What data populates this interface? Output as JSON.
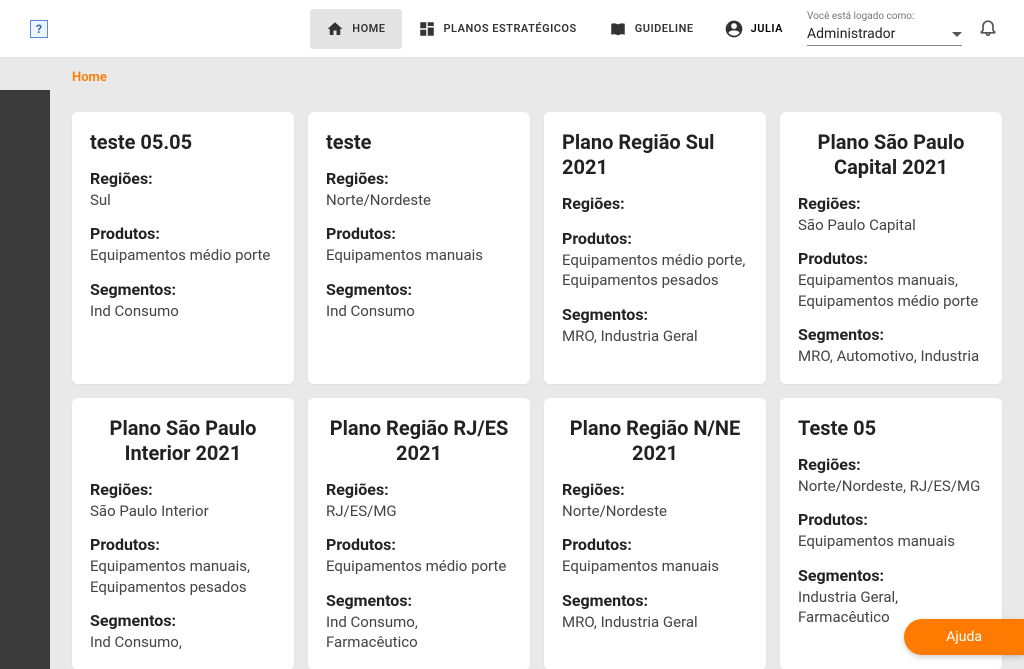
{
  "nav": {
    "home": "HOME",
    "planos": "PLANOS ESTRATÉGICOS",
    "guideline": "GUIDELINE",
    "user": "JULIA"
  },
  "role": {
    "label": "Você está logado como:",
    "value": "Administrador"
  },
  "breadcrumb": "Home",
  "labels": {
    "regioes": "Regiões:",
    "produtos": "Produtos:",
    "segmentos": "Segmentos:"
  },
  "cards": [
    {
      "title": "teste 05.05",
      "center": false,
      "regioes": "Sul",
      "produtos": "Equipamentos médio porte",
      "segmentos": "Ind Consumo"
    },
    {
      "title": "teste",
      "center": false,
      "regioes": "Norte/Nordeste",
      "produtos": "Equipamentos manuais",
      "segmentos": "Ind Consumo"
    },
    {
      "title": "Plano Região Sul 2021",
      "center": false,
      "regioes": "",
      "produtos": "Equipamentos médio porte, Equipamentos pesados",
      "segmentos": "MRO, Industria Geral"
    },
    {
      "title": "Plano São Paulo Capital 2021",
      "center": true,
      "regioes": "São Paulo Capital",
      "produtos": "Equipamentos manuais, Equipamentos médio porte",
      "segmentos": "MRO, Automotivo, Industria"
    },
    {
      "title": "Plano São Paulo Interior 2021",
      "center": true,
      "regioes": "São Paulo Interior",
      "produtos": "Equipamentos manuais, Equipamentos pesados",
      "segmentos": "Ind Consumo,"
    },
    {
      "title": "Plano Região RJ/ES 2021",
      "center": true,
      "regioes": "RJ/ES/MG",
      "produtos": "Equipamentos médio porte",
      "segmentos": "Ind Consumo, Farmacêutico"
    },
    {
      "title": "Plano Região N/NE 2021",
      "center": true,
      "regioes": "Norte/Nordeste",
      "produtos": "Equipamentos manuais",
      "segmentos": "MRO, Industria Geral"
    },
    {
      "title": "Teste 05",
      "center": false,
      "regioes": "Norte/Nordeste, RJ/ES/MG",
      "produtos": "Equipamentos manuais",
      "segmentos": "Industria Geral, Farmacêutico"
    }
  ],
  "help": "Ajuda"
}
